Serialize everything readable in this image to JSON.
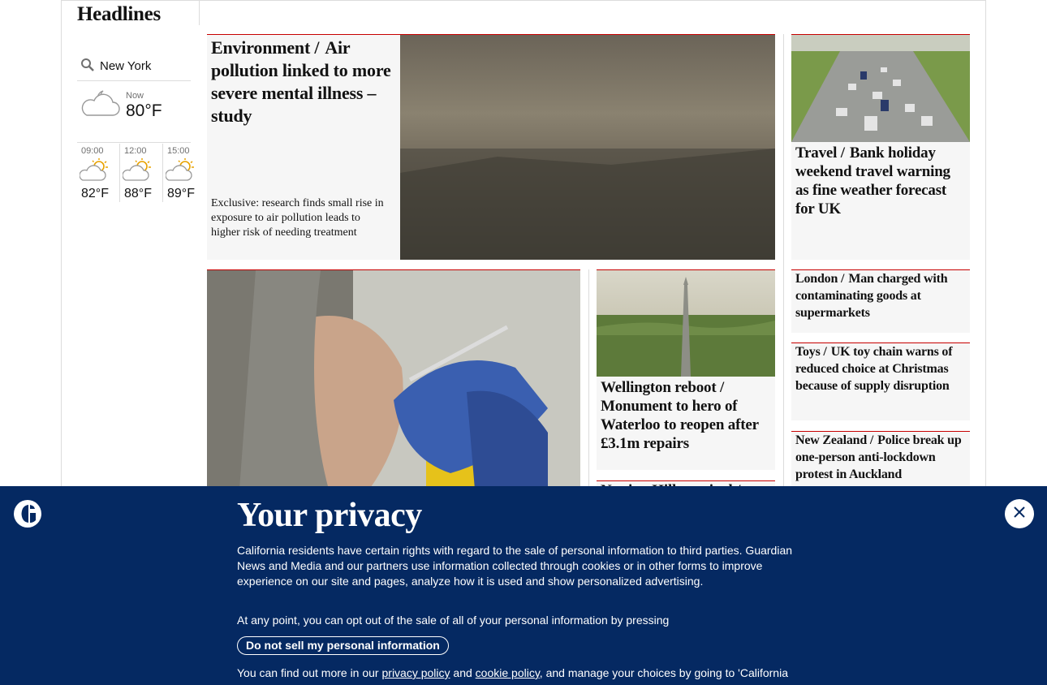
{
  "section": {
    "title": "Headlines"
  },
  "weather": {
    "location": "New York",
    "now_label": "Now",
    "now_temp": "80°F",
    "forecast": [
      {
        "time": "09:00",
        "temp": "82°F",
        "icon": "partly-sunny-icon"
      },
      {
        "time": "12:00",
        "temp": "88°F",
        "icon": "partly-sunny-icon"
      },
      {
        "time": "15:00",
        "temp": "89°F",
        "icon": "partly-sunny-icon"
      }
    ]
  },
  "stories": {
    "environment": {
      "kicker": "Environment /",
      "headline": "Air pollution linked to more severe mental illness – study",
      "standfirst": "Exclusive: research finds small rise in exposure to air pollution leads to higher risk of needing treatment"
    },
    "travel": {
      "kicker": "Travel /",
      "headline": "Bank holiday weekend travel warning as fine weather forecast for UK"
    },
    "london": {
      "kicker": "London /",
      "headline": "Man charged with contaminating goods at supermarkets"
    },
    "toys": {
      "kicker": "Toys /",
      "headline": "UK toy chain warns of reduced choice at Christmas because of supply disruption"
    },
    "newzealand": {
      "kicker": "New Zealand /",
      "headline": "Police break up one-person anti-lockdown protest in Auckland"
    },
    "wellington": {
      "kicker": "Wellington reboot /",
      "headline": "Monument to hero of Waterloo to reopen after £3.1m repairs"
    },
    "partial": {
      "kicker": "Netting Hill carnival /"
    }
  },
  "privacy": {
    "title": "Your privacy",
    "body": "California residents have certain rights with regard to the sale of personal information to third parties. Guardian News and Media and our partners use information collected through cookies or in other forms to improve experience on our site and pages, analyze how it is used and show personalized advertising.",
    "optout": "At any point, you can opt out of the sale of all of your personal information by pressing",
    "button": "Do not sell my personal information",
    "more_prefix": "You can find out more in our",
    "privacy_link": "privacy policy",
    "and": "and",
    "cookie_link": "cookie policy",
    "more_suffix": ", and manage your choices by going to 'California resident – Do Not Sell' at the bottom of any page."
  },
  "colors": {
    "accent": "#c70000",
    "banner": "#052962"
  }
}
